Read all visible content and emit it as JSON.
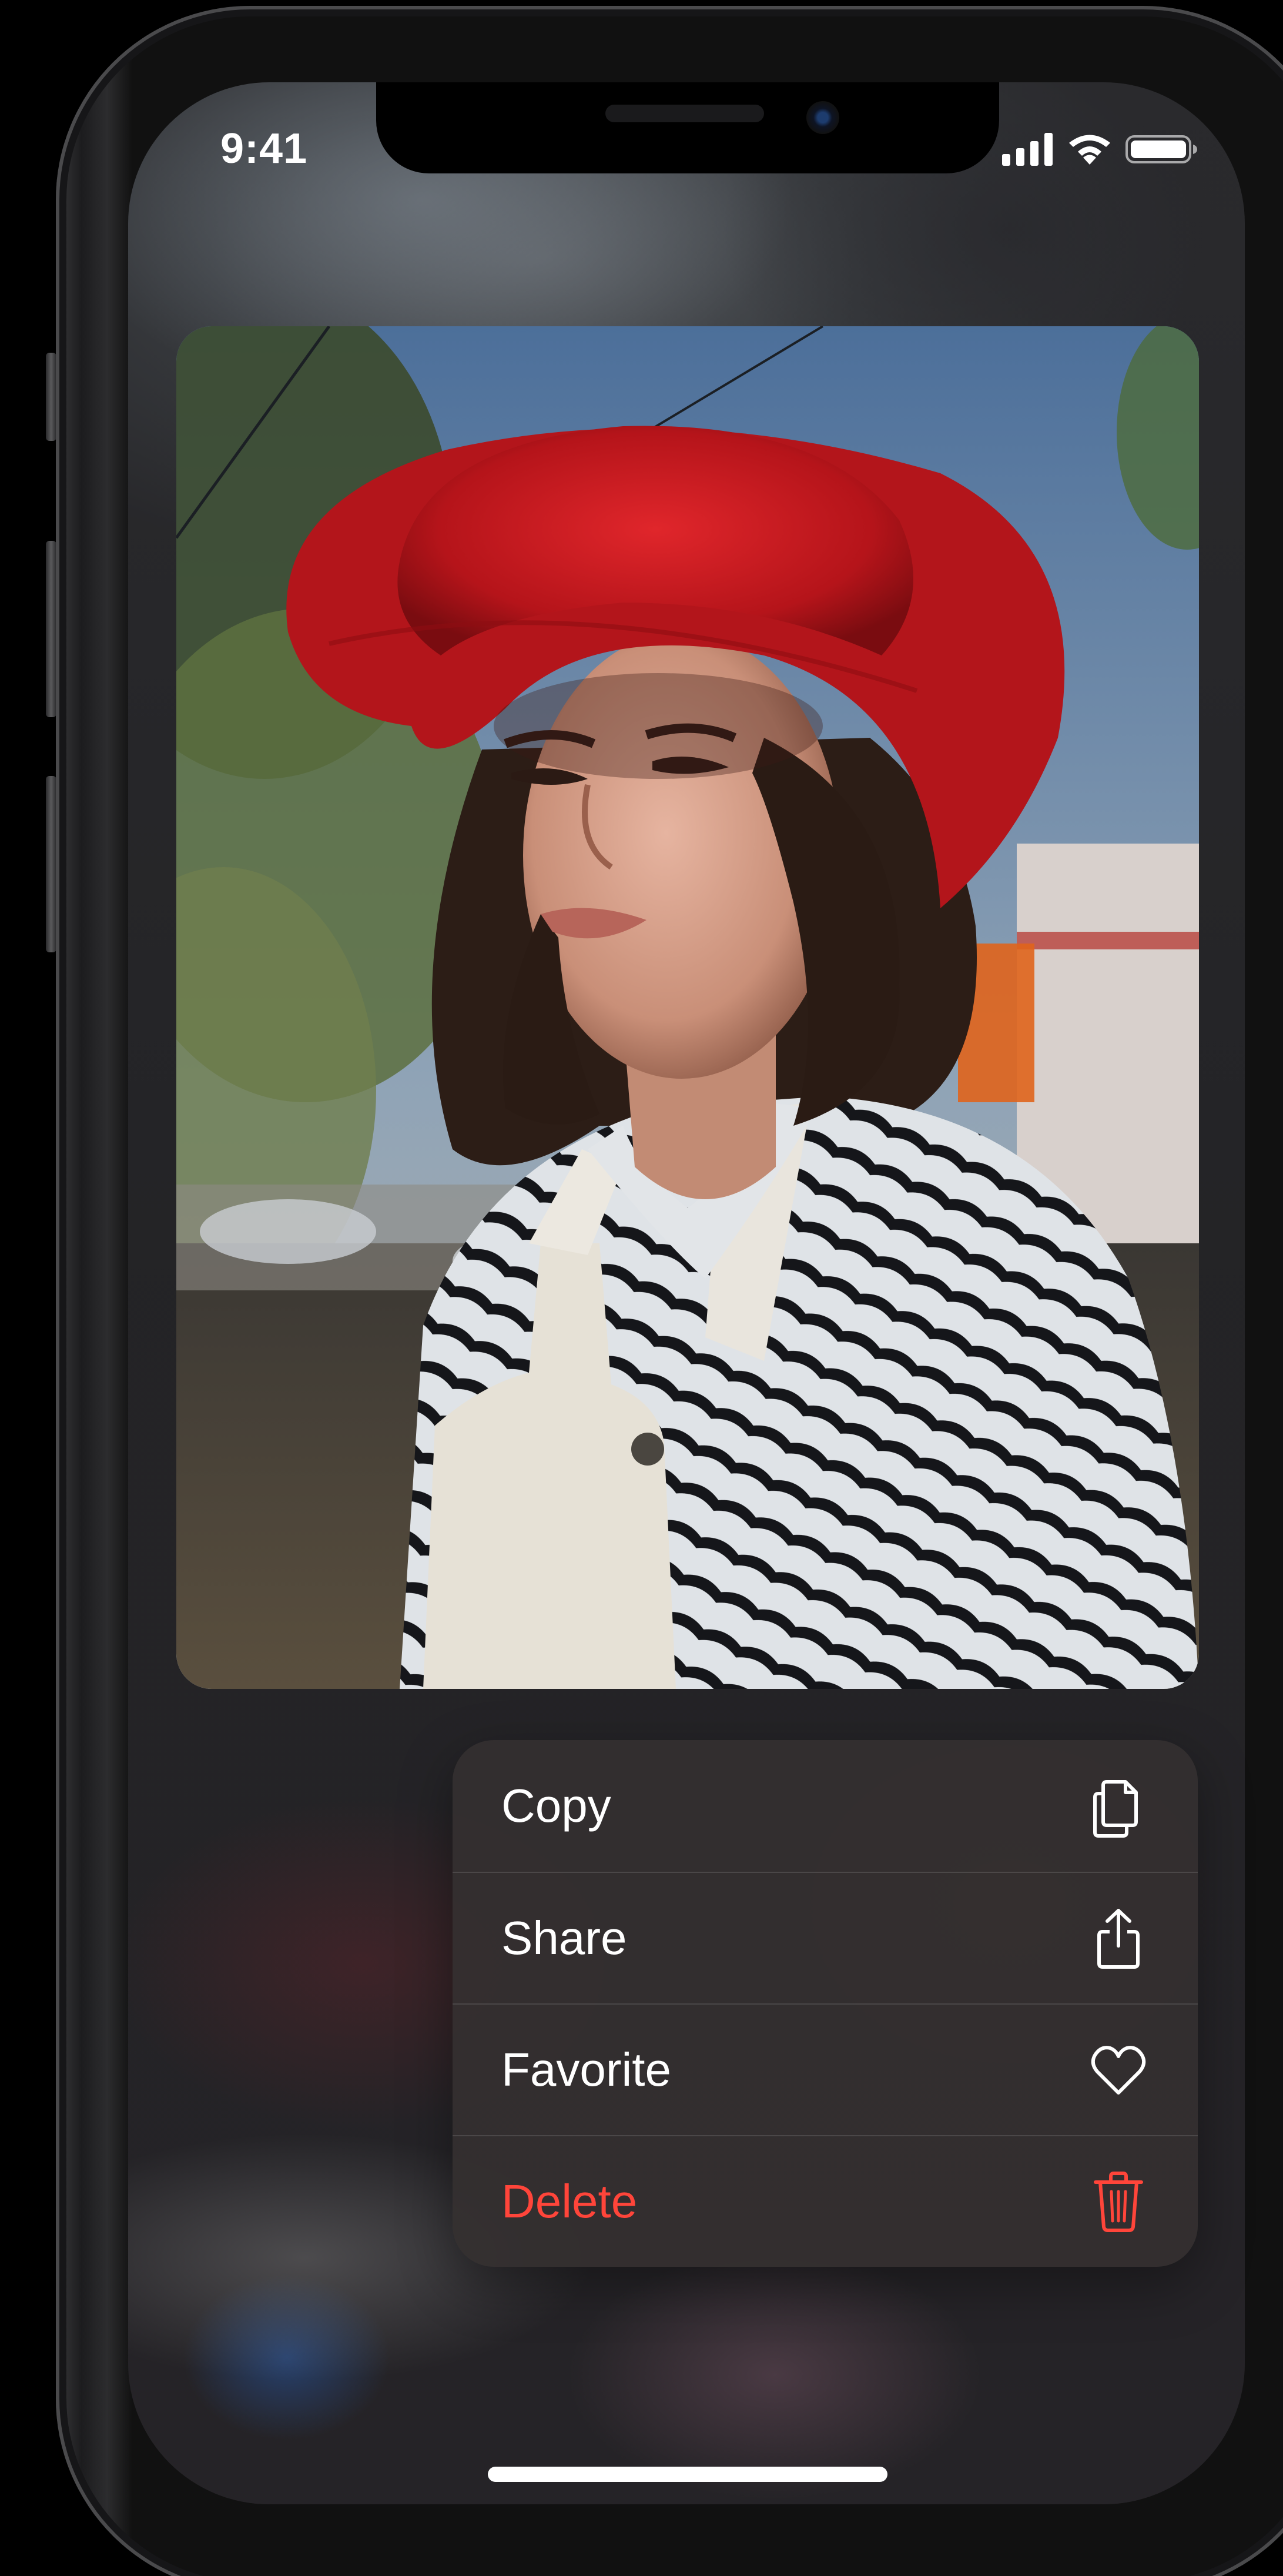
{
  "status_bar": {
    "time": "9:41",
    "icons": [
      "cellular-signal-icon",
      "wifi-icon",
      "battery-icon"
    ]
  },
  "preview": {
    "subject": "photo"
  },
  "context_menu": {
    "items": [
      {
        "label": "Copy",
        "icon": "copy-icon",
        "destructive": false
      },
      {
        "label": "Share",
        "icon": "share-icon",
        "destructive": false
      },
      {
        "label": "Favorite",
        "icon": "heart-icon",
        "destructive": false
      },
      {
        "label": "Delete",
        "icon": "trash-icon",
        "destructive": true
      }
    ]
  },
  "colors": {
    "destructive": "#ff453a",
    "menu_background": "#343030",
    "hat": "#c8181e"
  }
}
